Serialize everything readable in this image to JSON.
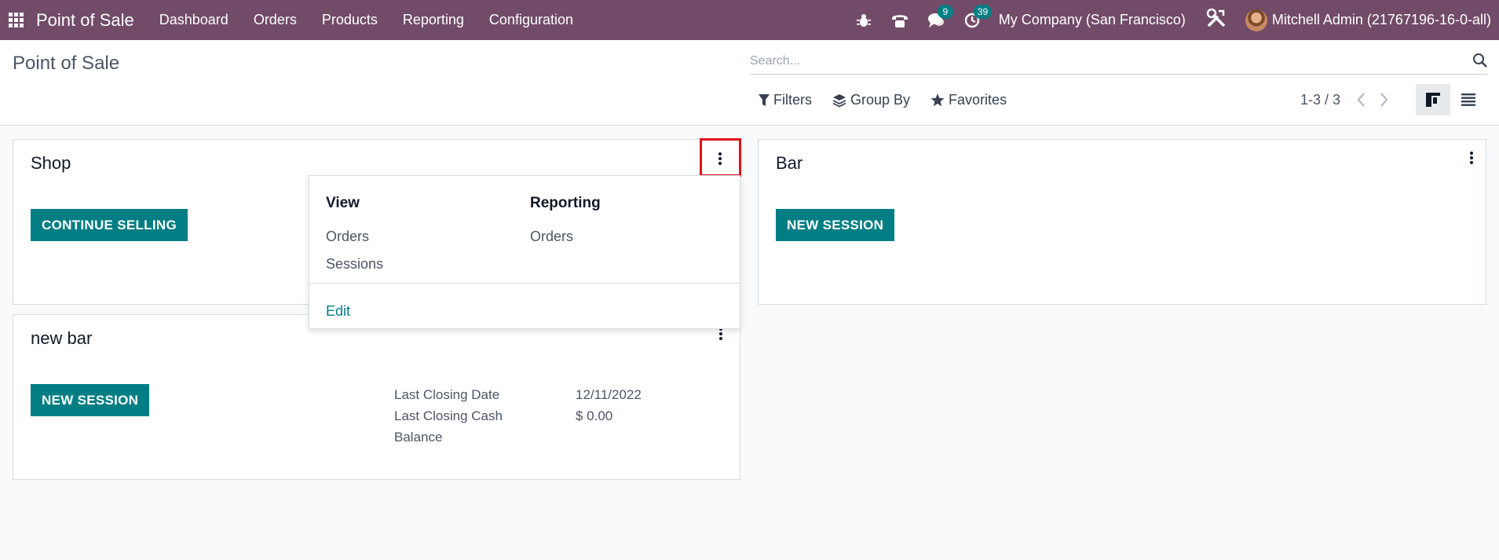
{
  "navbar": {
    "brand": "Point of Sale",
    "menu": [
      "Dashboard",
      "Orders",
      "Products",
      "Reporting",
      "Configuration"
    ],
    "messages_count": "9",
    "activities_count": "39",
    "company": "My Company (San Francisco)",
    "user": "Mitchell Admin (21767196-16-0-all)"
  },
  "control_panel": {
    "title": "Point of Sale",
    "search_placeholder": "Search...",
    "filters_label": "Filters",
    "group_by_label": "Group By",
    "favorites_label": "Favorites",
    "pager": "1-3 / 3"
  },
  "cards": {
    "shop": {
      "title": "Shop",
      "button": "CONTINUE SELLING"
    },
    "bar": {
      "title": "Bar",
      "button": "NEW SESSION"
    },
    "new_bar": {
      "title": "new bar",
      "button": "NEW SESSION",
      "last_closing_date_label": "Last Closing Date",
      "last_closing_date": "12/11/2022",
      "last_closing_cash_label_1": "Last Closing Cash",
      "last_closing_cash_label_2": "Balance",
      "last_closing_cash": "$ 0.00"
    }
  },
  "dropdown": {
    "view_header": "View",
    "view_items": [
      "Orders",
      "Sessions"
    ],
    "reporting_header": "Reporting",
    "reporting_items": [
      "Orders"
    ],
    "edit_label": "Edit"
  },
  "colors": {
    "navbar": "#714b67",
    "primary": "#017e84",
    "highlight": "#e0101a"
  },
  "icons": [
    "apps-grid-icon",
    "bug-icon",
    "phone-icon",
    "chat-icon",
    "clock-icon",
    "tools-icon",
    "search-icon",
    "filter-icon",
    "layers-icon",
    "star-icon",
    "chevron-left-icon",
    "chevron-right-icon",
    "kanban-view-icon",
    "list-view-icon",
    "kebab-icon"
  ]
}
